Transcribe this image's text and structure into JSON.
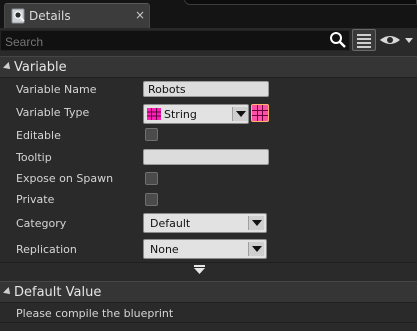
{
  "tab": {
    "title": "Details",
    "icon": "magnifier-details-icon",
    "close": "×"
  },
  "search": {
    "placeholder": "Search"
  },
  "sections": {
    "variable": "Variable",
    "default_value": "Default Value"
  },
  "variable": {
    "name_label": "Variable Name",
    "name_value": "Robots",
    "type_label": "Variable Type",
    "type_value": "String",
    "editable_label": "Editable",
    "tooltip_label": "Tooltip",
    "expose_label": "Expose on Spawn",
    "private_label": "Private",
    "category_label": "Category",
    "category_value": "Default",
    "replication_label": "Replication",
    "replication_value": "None"
  },
  "default_value": {
    "message": "Please compile the blueprint"
  },
  "colors": {
    "string_pin": "#ff1fb8",
    "grid_pin": "#ff4fa8"
  }
}
